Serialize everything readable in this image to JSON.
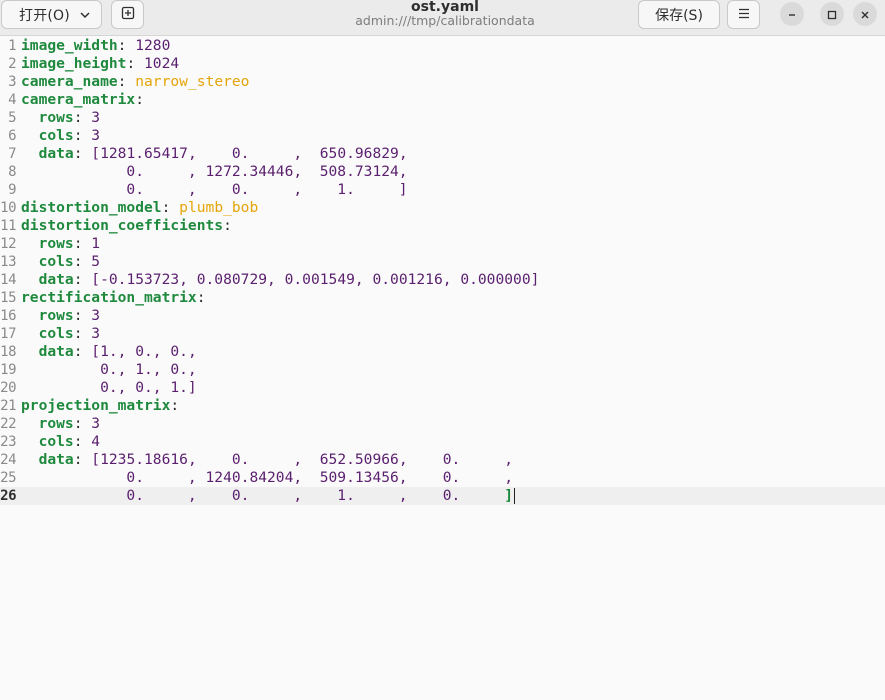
{
  "header": {
    "open_label": "打开(O)",
    "save_label": "保存(S)",
    "title": "ost.yaml",
    "subtitle": "admin:///tmp/calibrationdata"
  },
  "icons": {
    "open_chevron": "chevron-down-icon",
    "new_tab": "new-document-icon",
    "menu": "hamburger-menu-icon",
    "minimize": "minimize-icon",
    "maximize": "maximize-icon",
    "close": "close-icon"
  },
  "editor": {
    "current_line": 26,
    "lines": [
      {
        "n": "1",
        "key": "image_width",
        "rest": " 1280",
        "cls": "num"
      },
      {
        "n": "2",
        "key": "image_height",
        "rest": " 1024",
        "cls": "num"
      },
      {
        "n": "3",
        "key": "camera_name",
        "rest": " narrow_stereo",
        "cls": "str"
      },
      {
        "n": "4",
        "key": "camera_matrix",
        "rest": "",
        "cls": "num"
      },
      {
        "n": "5",
        "key": "  rows",
        "rest": " 3",
        "cls": "num"
      },
      {
        "n": "6",
        "key": "  cols",
        "rest": " 3",
        "cls": "num"
      },
      {
        "n": "7",
        "key": "  data",
        "rest": " [1281.65417,    0.     ,  650.96829,",
        "cls": "num"
      },
      {
        "n": "8",
        "key": "",
        "rest": "            0.     , 1272.34446,  508.73124,",
        "cls": "num"
      },
      {
        "n": "9",
        "key": "",
        "rest": "            0.     ,    0.     ,    1.     ]",
        "cls": "num"
      },
      {
        "n": "10",
        "key": "distortion_model",
        "rest": " plumb_bob",
        "cls": "str"
      },
      {
        "n": "11",
        "key": "distortion_coefficients",
        "rest": "",
        "cls": "num"
      },
      {
        "n": "12",
        "key": "  rows",
        "rest": " 1",
        "cls": "num"
      },
      {
        "n": "13",
        "key": "  cols",
        "rest": " 5",
        "cls": "num"
      },
      {
        "n": "14",
        "key": "  data",
        "rest": " [-0.153723, 0.080729, 0.001549, 0.001216, 0.000000]",
        "cls": "num"
      },
      {
        "n": "15",
        "key": "rectification_matrix",
        "rest": "",
        "cls": "num"
      },
      {
        "n": "16",
        "key": "  rows",
        "rest": " 3",
        "cls": "num"
      },
      {
        "n": "17",
        "key": "  cols",
        "rest": " 3",
        "cls": "num"
      },
      {
        "n": "18",
        "key": "  data",
        "rest": " [1., 0., 0.,",
        "cls": "num"
      },
      {
        "n": "19",
        "key": "",
        "rest": "         0., 1., 0.,",
        "cls": "num"
      },
      {
        "n": "20",
        "key": "",
        "rest": "         0., 0., 1.]",
        "cls": "num"
      },
      {
        "n": "21",
        "key": "projection_matrix",
        "rest": "",
        "cls": "num"
      },
      {
        "n": "22",
        "key": "  rows",
        "rest": " 3",
        "cls": "num"
      },
      {
        "n": "23",
        "key": "  cols",
        "rest": " 4",
        "cls": "num"
      },
      {
        "n": "24",
        "key": "  data",
        "rest": " [1235.18616,    0.     ,  652.50966,    0.     ,",
        "cls": "num"
      },
      {
        "n": "25",
        "key": "",
        "rest": "            0.     , 1240.84204,  509.13456,    0.     ,",
        "cls": "num"
      },
      {
        "n": "26",
        "key": "",
        "rest": "            0.     ,    0.     ,    1.     ,    0.     ]",
        "cls": "num"
      }
    ]
  }
}
